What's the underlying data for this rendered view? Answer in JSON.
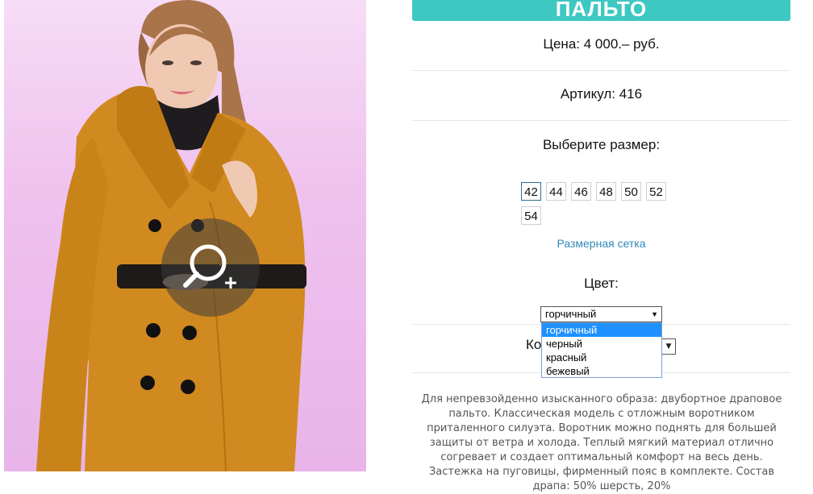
{
  "product": {
    "title": "ПАЛЬТО",
    "price_label": "Цена: 4 000.– руб.",
    "article_label": "Артикул: 416",
    "choose_size_label": "Выберите размер:",
    "sizes": [
      "42",
      "44",
      "46",
      "48",
      "50",
      "52",
      "54"
    ],
    "selected_size": "42",
    "size_chart_link": "Размерная сетка",
    "color_label": "Цвет:",
    "color_selected": "горчичный",
    "color_options": [
      "горчичный",
      "черный",
      "красный",
      "бежевый"
    ],
    "highlighted_option": "горчичный",
    "quantity_label_partial": "Ко",
    "description": "Для непревзойденно изысканного образа: двубортное драповое пальто. Классическая модель с отложным воротником приталенного силуэта. Воротник можно поднять для большей защиты от ветра и холода. Теплый мягкий материал отлично согревает и создает оптимальный комфорт на весь день. Застежка на пуговицы, фирменный пояс в комплекте. Состав драпа: 50% шерсть, 20%"
  },
  "colors": {
    "title_bar": "#3ec8c2",
    "link": "#2f8ab9",
    "coat": "#d18a1f",
    "dropdown_highlight": "#1e90ff"
  },
  "icons": {
    "zoom": "magnifier-plus-icon"
  }
}
